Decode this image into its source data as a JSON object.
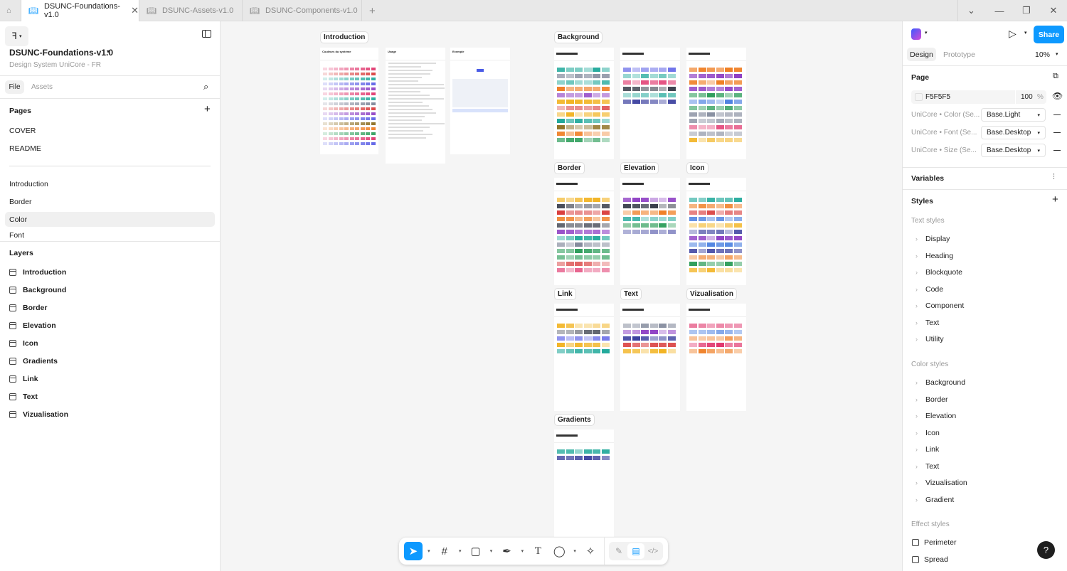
{
  "tabs": [
    {
      "label": "DSUNC-Foundations-v1.0",
      "active": true
    },
    {
      "label": "DSUNC-Assets-v1.0"
    },
    {
      "label": "DSUNC-Components-v1.0"
    }
  ],
  "left": {
    "file_title": "DSUNC-Foundations-v1.0",
    "file_subtitle": "Design System UniCore - FR",
    "tab_file": "File",
    "tab_assets": "Assets",
    "pages_header": "Pages",
    "pages": [
      "COVER",
      "README",
      "Introduction",
      "Border",
      "Color",
      "Font"
    ],
    "selected_page": "Color",
    "layers_header": "Layers",
    "layers": [
      "Introduction",
      "Background",
      "Border",
      "Elevation",
      "Icon",
      "Gradients",
      "Link",
      "Text",
      "Vizualisation"
    ]
  },
  "right": {
    "share": "Share",
    "tab_design": "Design",
    "tab_prototype": "Prototype",
    "zoom": "10%",
    "page_header": "Page",
    "page_color": "F5F5F5",
    "page_opacity": "100",
    "percent": "%",
    "modes": [
      {
        "label": "UniCore • Color (Se...",
        "value": "Base.Light"
      },
      {
        "label": "UniCore • Font (Se...",
        "value": "Base.Desktop"
      },
      {
        "label": "UniCore • Size (Se...",
        "value": "Base.Desktop"
      }
    ],
    "variables": "Variables",
    "styles": "Styles",
    "text_styles_header": "Text styles",
    "text_styles": [
      "Display",
      "Heading",
      "Blockquote",
      "Code",
      "Component",
      "Text",
      "Utility"
    ],
    "color_styles_header": "Color styles",
    "color_styles": [
      "Background",
      "Border",
      "Elevation",
      "Icon",
      "Link",
      "Text",
      "Vizualisation",
      "Gradient"
    ],
    "effect_styles_header": "Effect styles",
    "effect_styles": [
      "Perimeter",
      "Spread"
    ],
    "help": "?"
  },
  "canvas": {
    "sections": [
      "Introduction",
      "Background",
      "Border",
      "Elevation",
      "Icon",
      "Link",
      "Text",
      "Vizualisation",
      "Gradients"
    ],
    "frame_headings": [
      "Couleurs du système",
      "Usage",
      "Exemple"
    ],
    "palette": [
      "#2e9e5b",
      "#1fa89a",
      "#4a7fe0",
      "#5a5ee6",
      "#3a3f9e",
      "#8e3fc4",
      "#e0336b",
      "#d93b3b",
      "#ef7d22",
      "#f2b321",
      "#8a6a1a",
      "#7b8396",
      "#2f3442"
    ]
  },
  "colors": {
    "accent": "#0d99ff",
    "canvas": "#f5f5f5"
  }
}
